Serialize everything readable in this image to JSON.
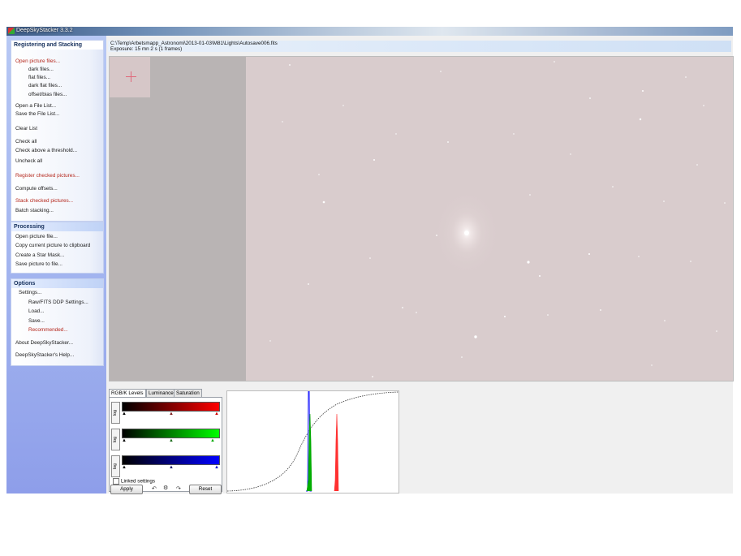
{
  "window": {
    "title": "DeepSkyStacker 3.3.2"
  },
  "sidebar": {
    "registering": {
      "header": "Registering and Stacking",
      "open_picture_files": "Open picture files...",
      "dark_files": "dark files...",
      "flat_files": "flat files...",
      "dark_flat_files": "dark flat files...",
      "offset_bias_files": "offset/bias files...",
      "open_file_list": "Open a File List...",
      "save_file_list": "Save the File List...",
      "clear_list": "Clear List",
      "check_all": "Check all",
      "check_above_threshold": "Check above a threshold...",
      "uncheck_all": "Uncheck all",
      "register_checked": "Register checked pictures...",
      "compute_offsets": "Compute offsets...",
      "stack_checked": "Stack checked pictures...",
      "batch_stacking": "Batch stacking..."
    },
    "processing": {
      "header": "Processing",
      "open_picture_file": "Open picture file...",
      "copy_to_clipboard": "Copy current picture to clipboard",
      "create_star_mask": "Create a Star Mask...",
      "save_picture": "Save picture to file..."
    },
    "options": {
      "header": "Options",
      "settings": "Settings...",
      "raw_fits_settings": "Raw/FITS DDP Settings...",
      "load": "Load...",
      "save": "Save...",
      "recommended": "Recommended...",
      "about": "About DeepSkyStacker...",
      "help": "DeepSkyStacker's Help..."
    }
  },
  "infobar": {
    "path": "C:\\Temp\\Arbetsmapp_Astronomi\\2013-01-03\\M81\\Lights\\Autosave006.fits",
    "exposure": "Exposure: 15 mn 2 s (1 frames)"
  },
  "levels": {
    "tabs": [
      "RGB/K Levels",
      "Luminance",
      "Saturation"
    ],
    "log_label": "log",
    "linked_settings": "Linked settings",
    "apply": "Apply",
    "reset": "Reset",
    "channels": [
      {
        "name": "red",
        "color": "#ff0000",
        "mid": 0.49,
        "end": 0.97
      },
      {
        "name": "green",
        "color": "#00ff00",
        "mid": 0.49,
        "end": 0.93
      },
      {
        "name": "blue",
        "color": "#0000ff",
        "mid": 0.49,
        "end": 0.97
      }
    ]
  },
  "colors": {
    "sidebar_bg": "#9fb1ee",
    "image_bg": "#d9cccd",
    "highlight_text": "#b4261b"
  }
}
